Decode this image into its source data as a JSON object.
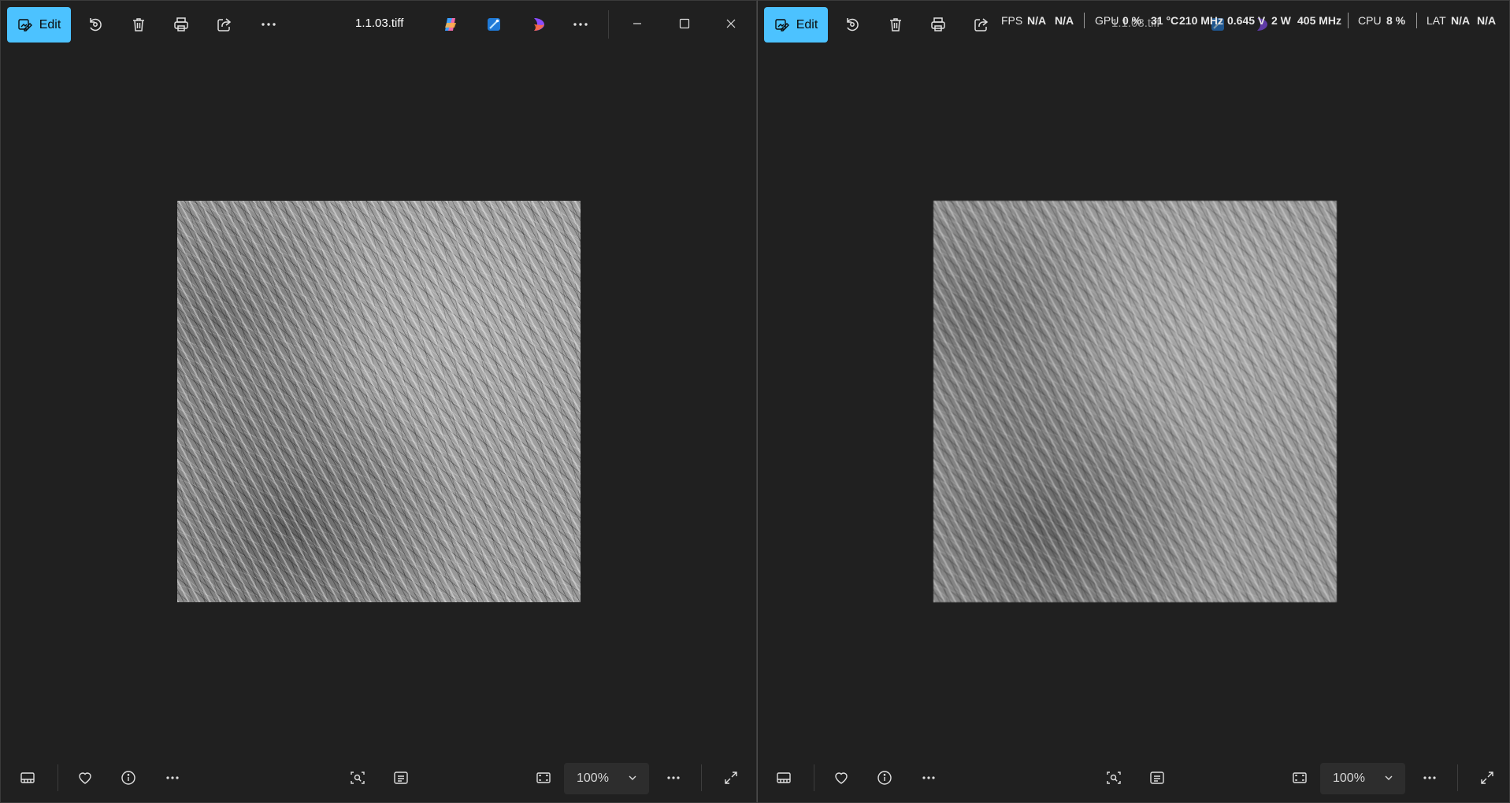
{
  "left_window": {
    "edit_label": "Edit",
    "filename": "1.1.03.tiff",
    "zoom": "100%"
  },
  "right_window": {
    "edit_label": "Edit",
    "filename": "1.1.03.tiff",
    "zoom": "100%"
  },
  "perf_overlay": {
    "fps_label": "FPS",
    "fps_value": "N/A",
    "fps_value2": "N/A",
    "gpu_label": "GPU",
    "gpu_load": "0 %",
    "gpu_temp": "31 °C",
    "gpu_clock": "210 MHz",
    "gpu_voltage": "0.645 V",
    "gpu_power": "2 W",
    "gpu_mem_clock": "405 MHz",
    "cpu_label": "CPU",
    "cpu_load": "8 %",
    "lat_label": "LAT",
    "lat_value": "N/A",
    "lat_value2": "N/A"
  },
  "icons": {
    "edit": "edit-image-icon",
    "rotate": "rotate-icon",
    "delete": "trash-icon",
    "print": "print-icon",
    "share": "share-icon",
    "more": "more-icon",
    "copilot": "copilot-icon",
    "designer": "designer-icon",
    "clipchamp": "clipchamp-icon",
    "minimize": "minimize-icon",
    "maximize": "maximize-icon",
    "close": "close-icon",
    "filmstrip": "filmstrip-icon",
    "favorite": "heart-icon",
    "info": "info-icon",
    "visual_search": "visual-search-icon",
    "text_scan": "text-scan-icon",
    "fit": "fit-to-window-icon",
    "fullscreen": "fullscreen-icon"
  },
  "colors": {
    "accent": "#4cc2ff",
    "window_bg": "#202020",
    "zoom_bg": "#2d2d2d"
  }
}
